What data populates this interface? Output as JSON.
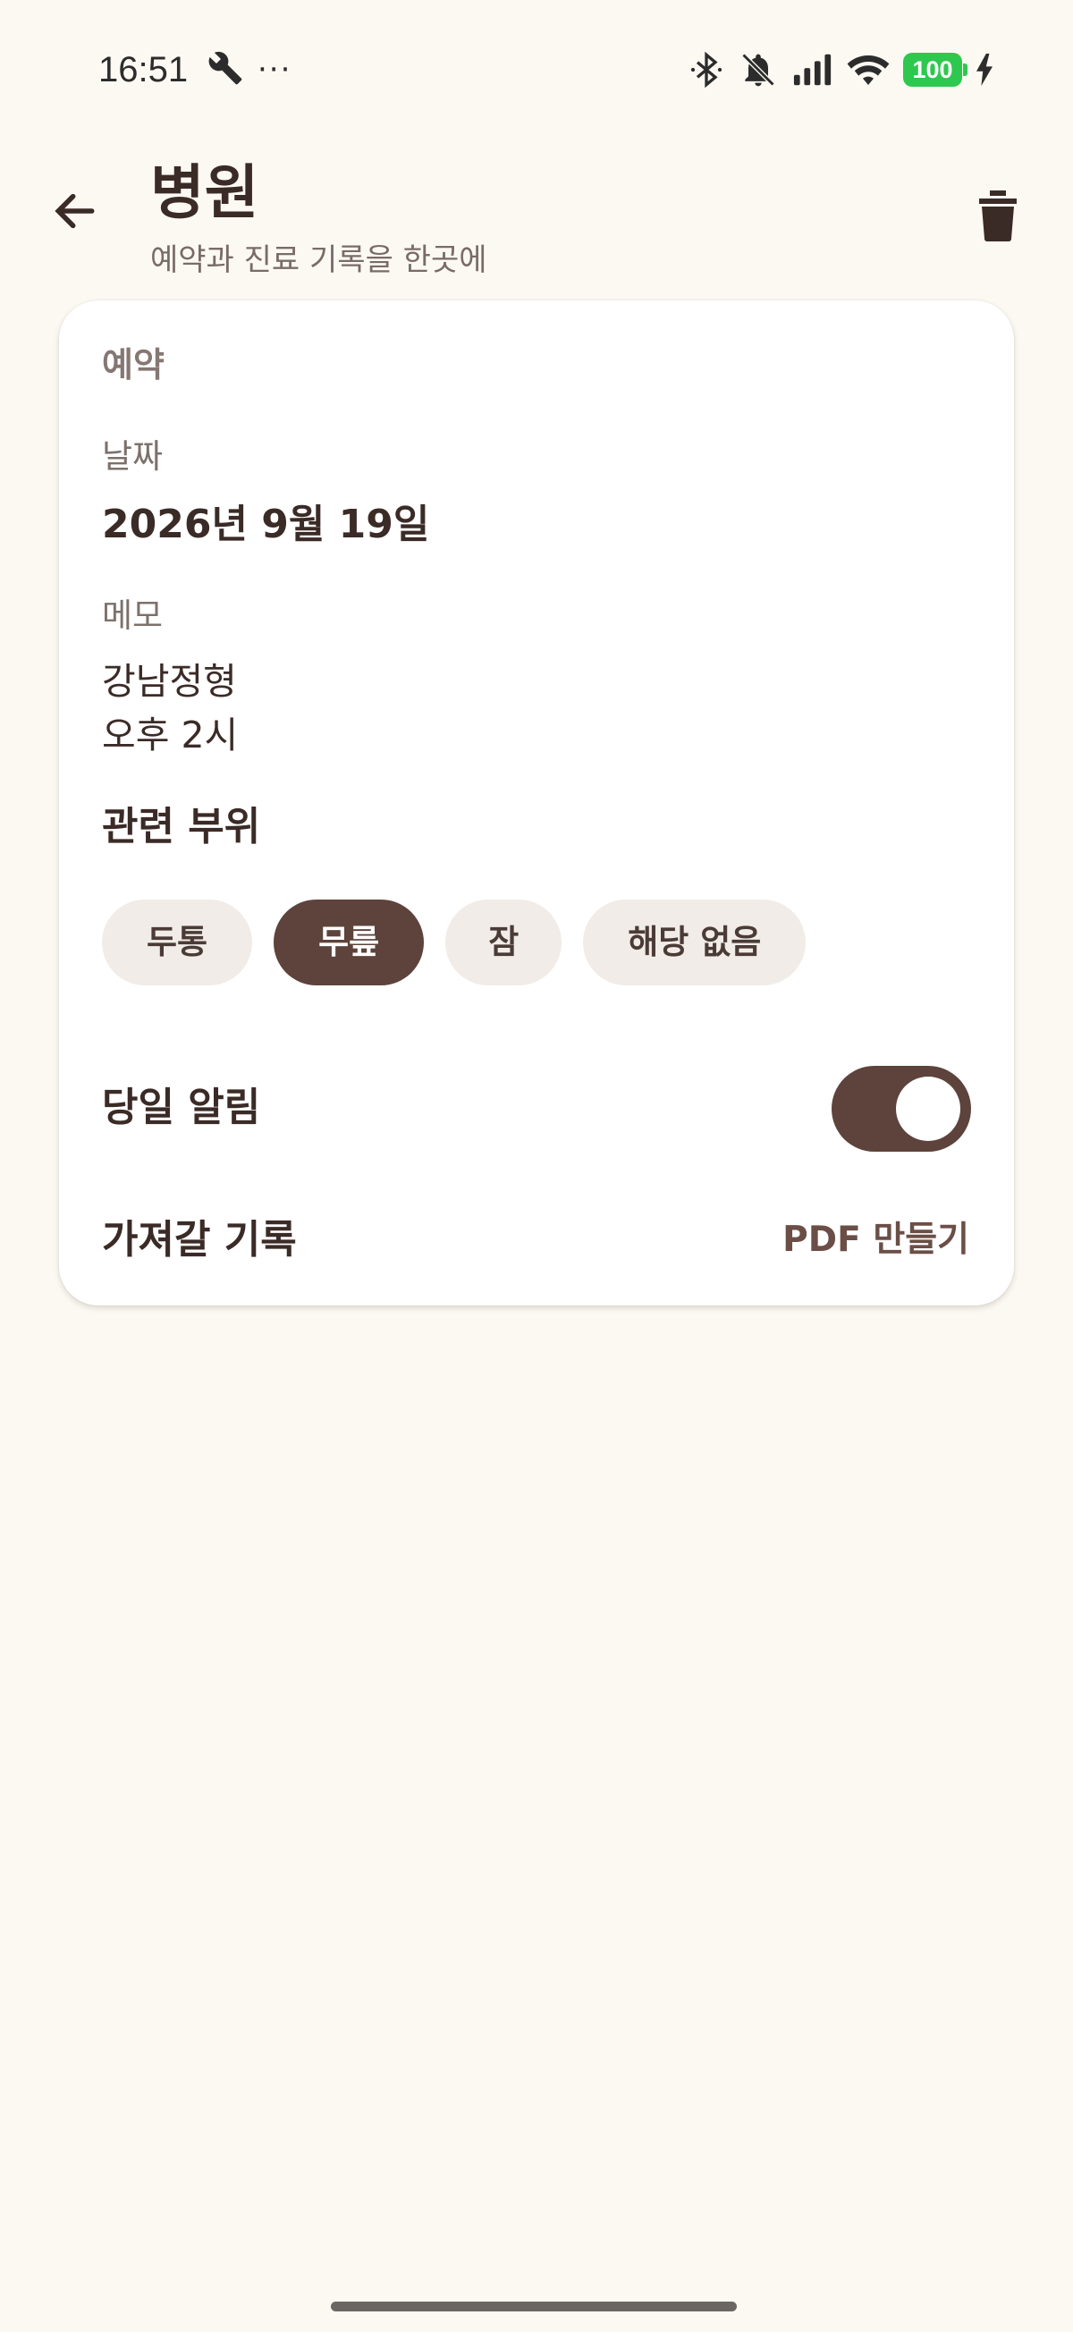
{
  "status_bar": {
    "time": "16:51",
    "more": "···",
    "battery": "100",
    "icons": [
      "wrench-icon",
      "bluetooth-icon",
      "silent-bell-icon",
      "signal-icon",
      "wifi-icon",
      "battery-icon",
      "charging-icon"
    ]
  },
  "header": {
    "title": "병원",
    "subtitle": "예약과 진료 기록을 한곳에",
    "icons": [
      "back-arrow-icon",
      "trash-icon"
    ]
  },
  "card": {
    "section_title": "예약",
    "date_label": "날짜",
    "date_value": "2026년 9월 19일",
    "memo_label": "메모",
    "memo_lines": [
      "강남정형",
      "오후 2시"
    ],
    "related_title": "관련 부위",
    "chips": [
      {
        "label": "두통",
        "selected": false
      },
      {
        "label": "무릎",
        "selected": true
      },
      {
        "label": "잠",
        "selected": false
      },
      {
        "label": "해당 없음",
        "selected": false
      }
    ],
    "alarm_label": "당일 알림",
    "alarm_on": true,
    "records_label": "가져갈 기록",
    "pdf_label": "PDF 만들기"
  },
  "colors": {
    "background": "#fcf9f3",
    "card": "#ffffff",
    "accent": "#5d433b",
    "chip": "#f1ece7",
    "battery": "#2ec84e"
  }
}
